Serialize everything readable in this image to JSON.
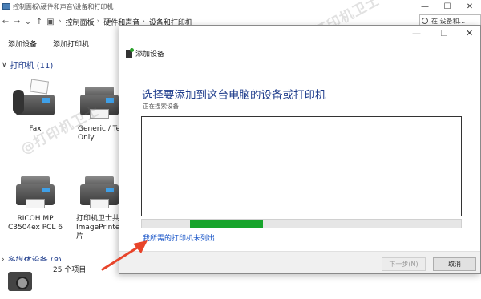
{
  "explorer": {
    "title": "控制面板\\硬件和声音\\设备和打印机",
    "breadcrumb": [
      "控制面板",
      "硬件和声音",
      "设备和打印机"
    ],
    "search_label": "在 设备和...",
    "toolbar": {
      "add_device": "添加设备",
      "add_printer": "添加打印机"
    },
    "group_printers": "打印机 (11)",
    "group_multimedia": "多媒体设备 (8)",
    "devices": [
      {
        "label": "Fax"
      },
      {
        "label": "Generic / Te\nOnly"
      },
      {
        "label": "RICOH MP\nC3504ex PCL 6"
      },
      {
        "label": "打印机卫士共\nImagePrinter\n片"
      }
    ],
    "status_count": "25 个项目"
  },
  "dialog": {
    "window_title": "添加设备",
    "heading": "选择要添加到这台电脑的设备或打印机",
    "subtext": "正在搜索设备",
    "progress": {
      "start": 0.15,
      "end": 0.38,
      "color": "#17a42b"
    },
    "link": "我所需的打印机未列出",
    "next_button": "下一步(N)",
    "cancel_button": "取消"
  },
  "watermark": "@打印机卫士",
  "colors": {
    "heading": "#1e3c8c",
    "link": "#1a56c8",
    "arrow": "#e8442a"
  }
}
